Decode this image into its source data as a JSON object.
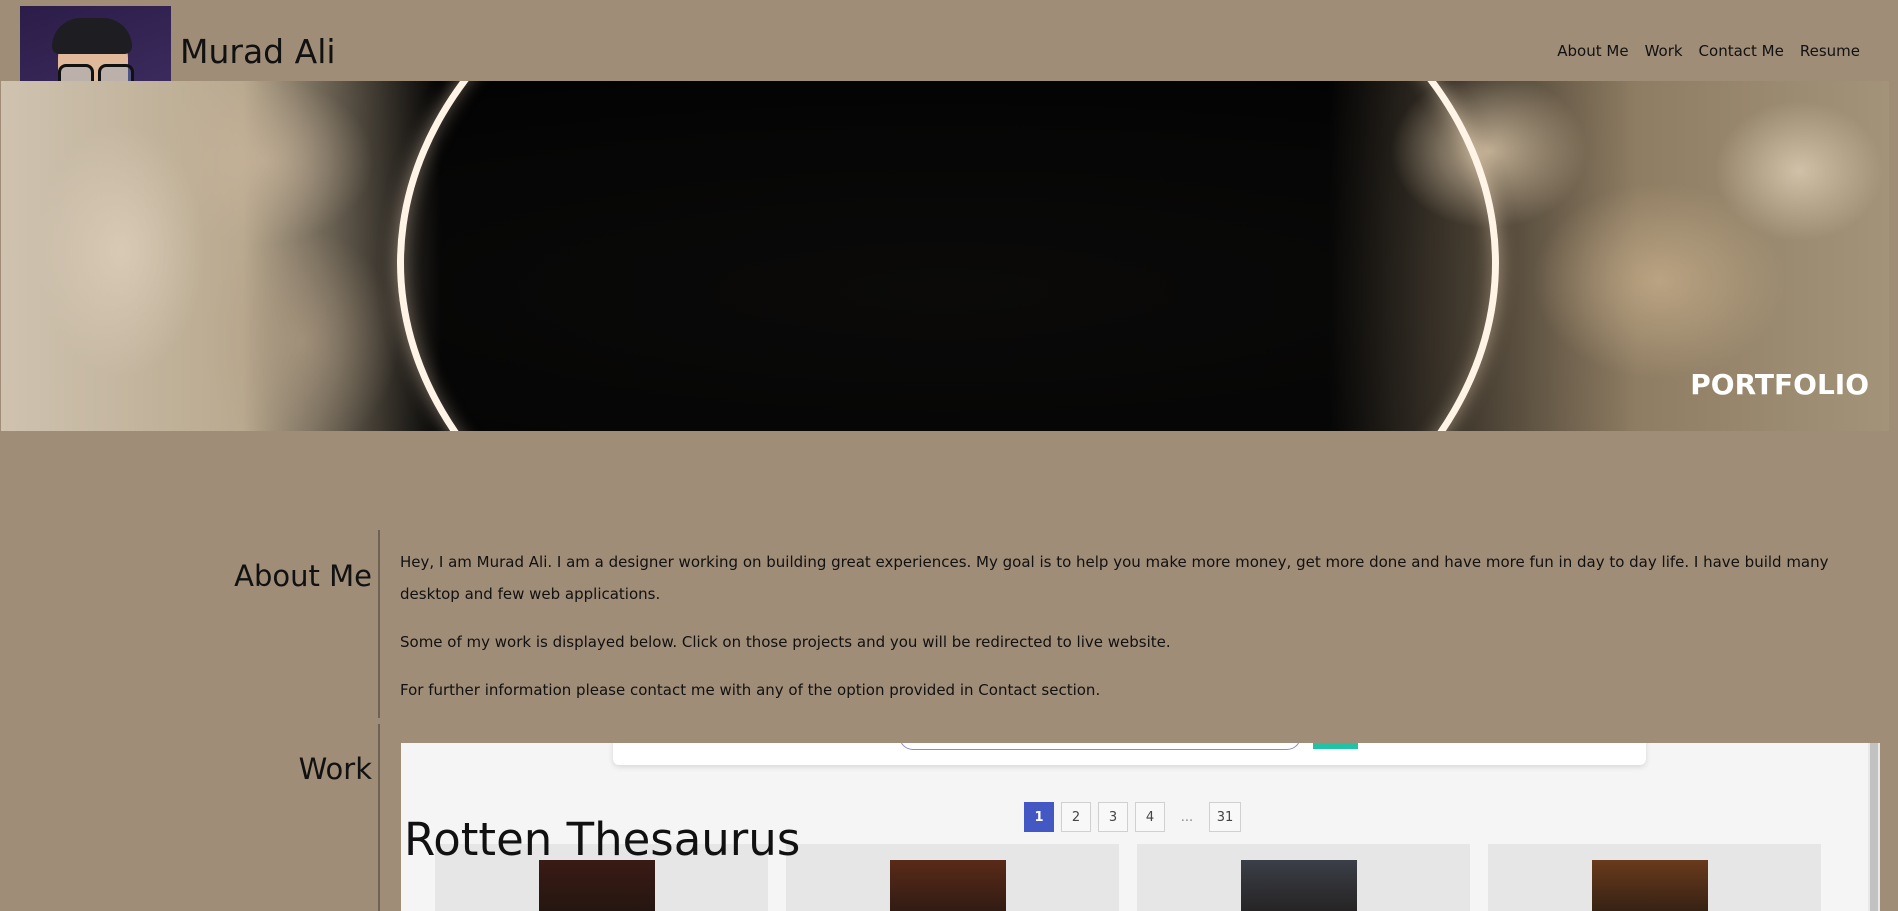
{
  "header": {
    "name": "Murad Ali",
    "nav": [
      "About Me",
      "Work",
      "Contact Me",
      "Resume"
    ]
  },
  "hero": {
    "label": "PORTFOLIO"
  },
  "about": {
    "title": "About Me",
    "paragraphs": [
      "Hey, I am Murad Ali. I am a designer working on building great experiences. My goal is to help you make more money, get more done and have more fun in day to day life. I have build many desktop and few web applications.",
      "Some of my work is displayed below. Click on those projects and you will be redirected to live website.",
      "For further information please contact me with any of the option provided in Contact section."
    ]
  },
  "work": {
    "title": "Work",
    "project_title": "Rotten Thesaurus",
    "pagination": [
      "1",
      "2",
      "3",
      "4",
      "...",
      "31"
    ],
    "active_page": "1",
    "poster_colors": [
      "#3a1a14",
      "#5a2a18",
      "#3b3f48",
      "#6a3a1c"
    ]
  },
  "colors": {
    "page_bg": "#a08d78",
    "pager_active": "#4458c4",
    "search_button": "#1fc3a6"
  }
}
